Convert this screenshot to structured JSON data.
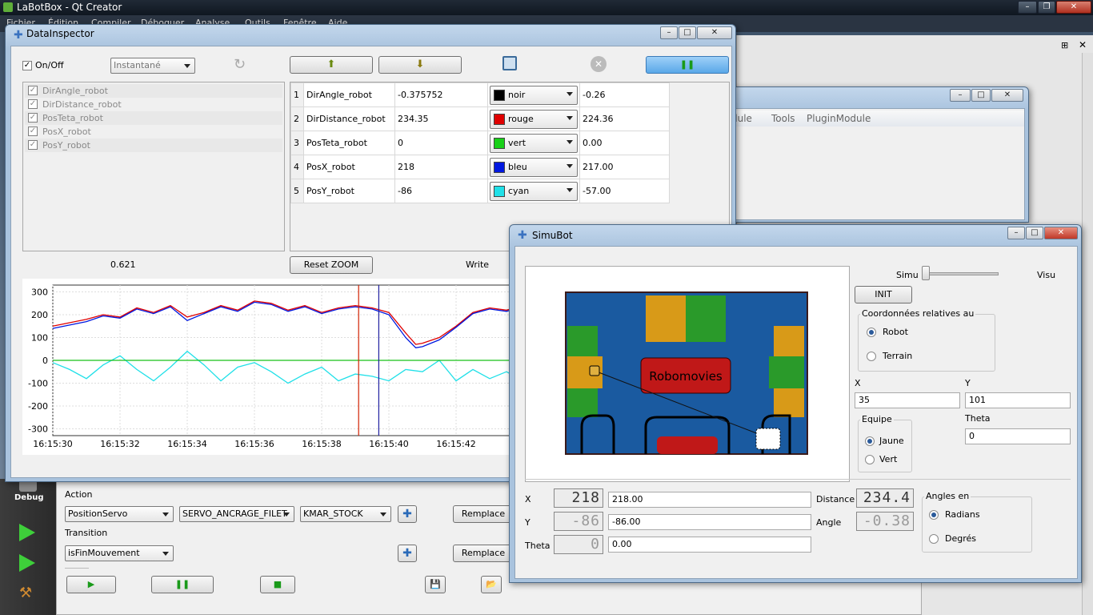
{
  "app": {
    "title": "LaBotBox - Qt Creator",
    "menubar": [
      "Fichier",
      "Édition",
      "Compiler",
      "Déboguer",
      "Analyse",
      "Outils",
      "Fenêtre",
      "Aide"
    ]
  },
  "qt_sidebar": {
    "debug_label": "Debug"
  },
  "bg_menu": [
    "dule",
    "Tools",
    "PluginModule"
  ],
  "data_inspector": {
    "title": "DataInspector",
    "onoff_label": "On/Off",
    "mode_value": "Instantané",
    "signals": [
      "DirAngle_robot",
      "DirDistance_robot",
      "PosTeta_robot",
      "PosX_robot",
      "PosY_robot"
    ],
    "table": [
      {
        "n": "1",
        "name": "DirAngle_robot",
        "value": "-0.375752",
        "color_name": "noir",
        "color": "#000000",
        "cursor": "-0.26"
      },
      {
        "n": "2",
        "name": "DirDistance_robot",
        "value": "234.35",
        "color_name": "rouge",
        "color": "#e00000",
        "cursor": "224.36"
      },
      {
        "n": "3",
        "name": "PosTeta_robot",
        "value": "0",
        "color_name": "vert",
        "color": "#18d018",
        "cursor": "0.00"
      },
      {
        "n": "4",
        "name": "PosX_robot",
        "value": "218",
        "color_name": "bleu",
        "color": "#0018e0",
        "cursor": "217.00"
      },
      {
        "n": "5",
        "name": "PosY_robot",
        "value": "-86",
        "color_name": "cyan",
        "color": "#20e0e8",
        "cursor": "-57.00"
      }
    ],
    "zoom_value": "0.621",
    "reset_zoom_label": "Reset ZOOM",
    "write_label": "Write"
  },
  "chart_data": {
    "type": "line",
    "title": "",
    "xlabel": "",
    "ylabel": "",
    "ylim": [
      -330,
      330
    ],
    "xlim": [
      0,
      20
    ],
    "yticks": [
      "300",
      "200",
      "100",
      "0",
      "-100",
      "-200",
      "-300"
    ],
    "ytick_values": [
      300,
      200,
      100,
      0,
      -100,
      -200,
      -300
    ],
    "xticks": [
      "16:15:30",
      "16:15:32",
      "16:15:34",
      "16:15:36",
      "16:15:38",
      "16:15:40",
      "16:15:42"
    ],
    "xtick_values": [
      0,
      2,
      4,
      6,
      8,
      10,
      12
    ],
    "grid": true,
    "cursors": [
      {
        "x": 9.1,
        "color": "#d02000"
      },
      {
        "x": 9.7,
        "color": "#2020a0"
      }
    ],
    "series": [
      {
        "name": "DirDistance_robot",
        "color": "#e00000",
        "x": [
          0,
          1,
          1.5,
          2,
          2.5,
          3,
          3.5,
          4,
          4.5,
          5,
          5.5,
          6,
          6.5,
          7,
          7.5,
          8,
          8.5,
          9,
          9.5,
          10,
          10.5,
          10.8,
          11,
          11.5,
          12,
          12.5,
          13,
          13.5,
          14
        ],
        "values": [
          150,
          180,
          200,
          190,
          230,
          210,
          240,
          190,
          210,
          240,
          220,
          260,
          250,
          220,
          240,
          210,
          230,
          240,
          230,
          210,
          120,
          70,
          75,
          100,
          150,
          210,
          230,
          220,
          240
        ]
      },
      {
        "name": "PosX_robot",
        "color": "#0018e0",
        "x": [
          0,
          1,
          1.5,
          2,
          2.5,
          3,
          3.5,
          4,
          4.5,
          5,
          5.5,
          6,
          6.5,
          7,
          7.5,
          8,
          8.5,
          9,
          9.5,
          10,
          10.5,
          10.8,
          11,
          11.5,
          12,
          12.5,
          13,
          13.5,
          14
        ],
        "values": [
          140,
          170,
          195,
          185,
          225,
          205,
          235,
          175,
          205,
          235,
          215,
          255,
          245,
          215,
          235,
          205,
          225,
          235,
          225,
          200,
          100,
          55,
          60,
          90,
          145,
          205,
          225,
          215,
          235
        ]
      },
      {
        "name": "PosY_robot",
        "color": "#20e0e8",
        "x": [
          0,
          0.5,
          1,
          1.5,
          2,
          2.5,
          3,
          3.5,
          4,
          4.5,
          5,
          5.5,
          6,
          6.5,
          7,
          7.5,
          8,
          8.5,
          9,
          9.5,
          10,
          10.5,
          11,
          11.5,
          12,
          12.5,
          13,
          13.5,
          14
        ],
        "values": [
          -10,
          -40,
          -80,
          -20,
          20,
          -40,
          -90,
          -30,
          40,
          -20,
          -90,
          -30,
          -10,
          -50,
          -100,
          -60,
          -30,
          -90,
          -60,
          -70,
          -90,
          -40,
          -50,
          0,
          -90,
          -40,
          -80,
          -50,
          -90
        ]
      },
      {
        "name": "PosTeta_robot",
        "color": "#18c018",
        "x": [
          0,
          14
        ],
        "values": [
          0,
          0
        ]
      }
    ]
  },
  "bottom_panel": {
    "action_label": "Action",
    "action_combo": "PositionServo",
    "servo_combo": "SERVO_ANCRAGE_FILET",
    "kmar_combo": "KMAR_STOCK",
    "remplace_label": "Remplace",
    "transition_label": "Transition",
    "transition_combo": "isFinMouvement"
  },
  "simubot": {
    "title": "SimuBot",
    "simu_label": "Simu",
    "visu_label": "Visu",
    "slider_value": 0,
    "init_label": "INIT",
    "coord_group": "Coordonnées relatives au",
    "robot_label": "Robot",
    "terrain_label": "Terrain",
    "x_label": "X",
    "y_label": "Y",
    "x_value": "35",
    "y_value": "101",
    "equipe_label": "Equipe",
    "jaune_label": "Jaune",
    "vert_label": "Vert",
    "theta_label": "Theta",
    "theta_value": "0",
    "board_text": "Robomovies",
    "lcd_x": "218",
    "field_x": "218.00",
    "lcd_y": "-86",
    "field_y": "-86.00",
    "lcd_theta": "0",
    "field_theta": "0.00",
    "distance_label": "Distance",
    "lcd_distance": "234.4",
    "angle_label": "Angle",
    "lcd_angle": "-0.38",
    "angles_group": "Angles en",
    "radians_label": "Radians",
    "degres_label": "Degrés"
  }
}
